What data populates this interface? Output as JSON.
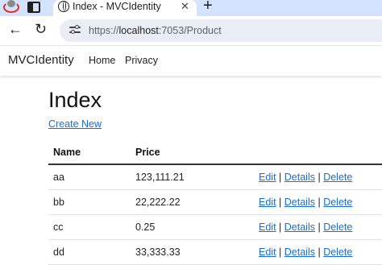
{
  "browser": {
    "tab_title": "Index - MVCIdentity",
    "tab_close": "✕",
    "new_tab": "+",
    "back": "←",
    "reload": "↻",
    "url_scheme": "https://",
    "url_host": "localhost",
    "url_rest": ":7053/Product"
  },
  "navbar": {
    "brand": "MVCIdentity",
    "links": [
      "Home",
      "Privacy"
    ]
  },
  "page": {
    "title": "Index",
    "create_link": "Create New"
  },
  "table": {
    "columns": [
      "Name",
      "Price"
    ],
    "rows": [
      {
        "name": "aa",
        "price": "123,111.21"
      },
      {
        "name": "bb",
        "price": "22,222.22"
      },
      {
        "name": "cc",
        "price": "0.25"
      },
      {
        "name": "dd",
        "price": "33,333.33"
      }
    ],
    "actions": {
      "edit": "Edit",
      "details": "Details",
      "delete": "Delete",
      "separator": "|"
    }
  },
  "colors": {
    "link": "#1b6ec2",
    "tabstrip": "#d3e3fd",
    "omnibox": "#e9eef6"
  }
}
